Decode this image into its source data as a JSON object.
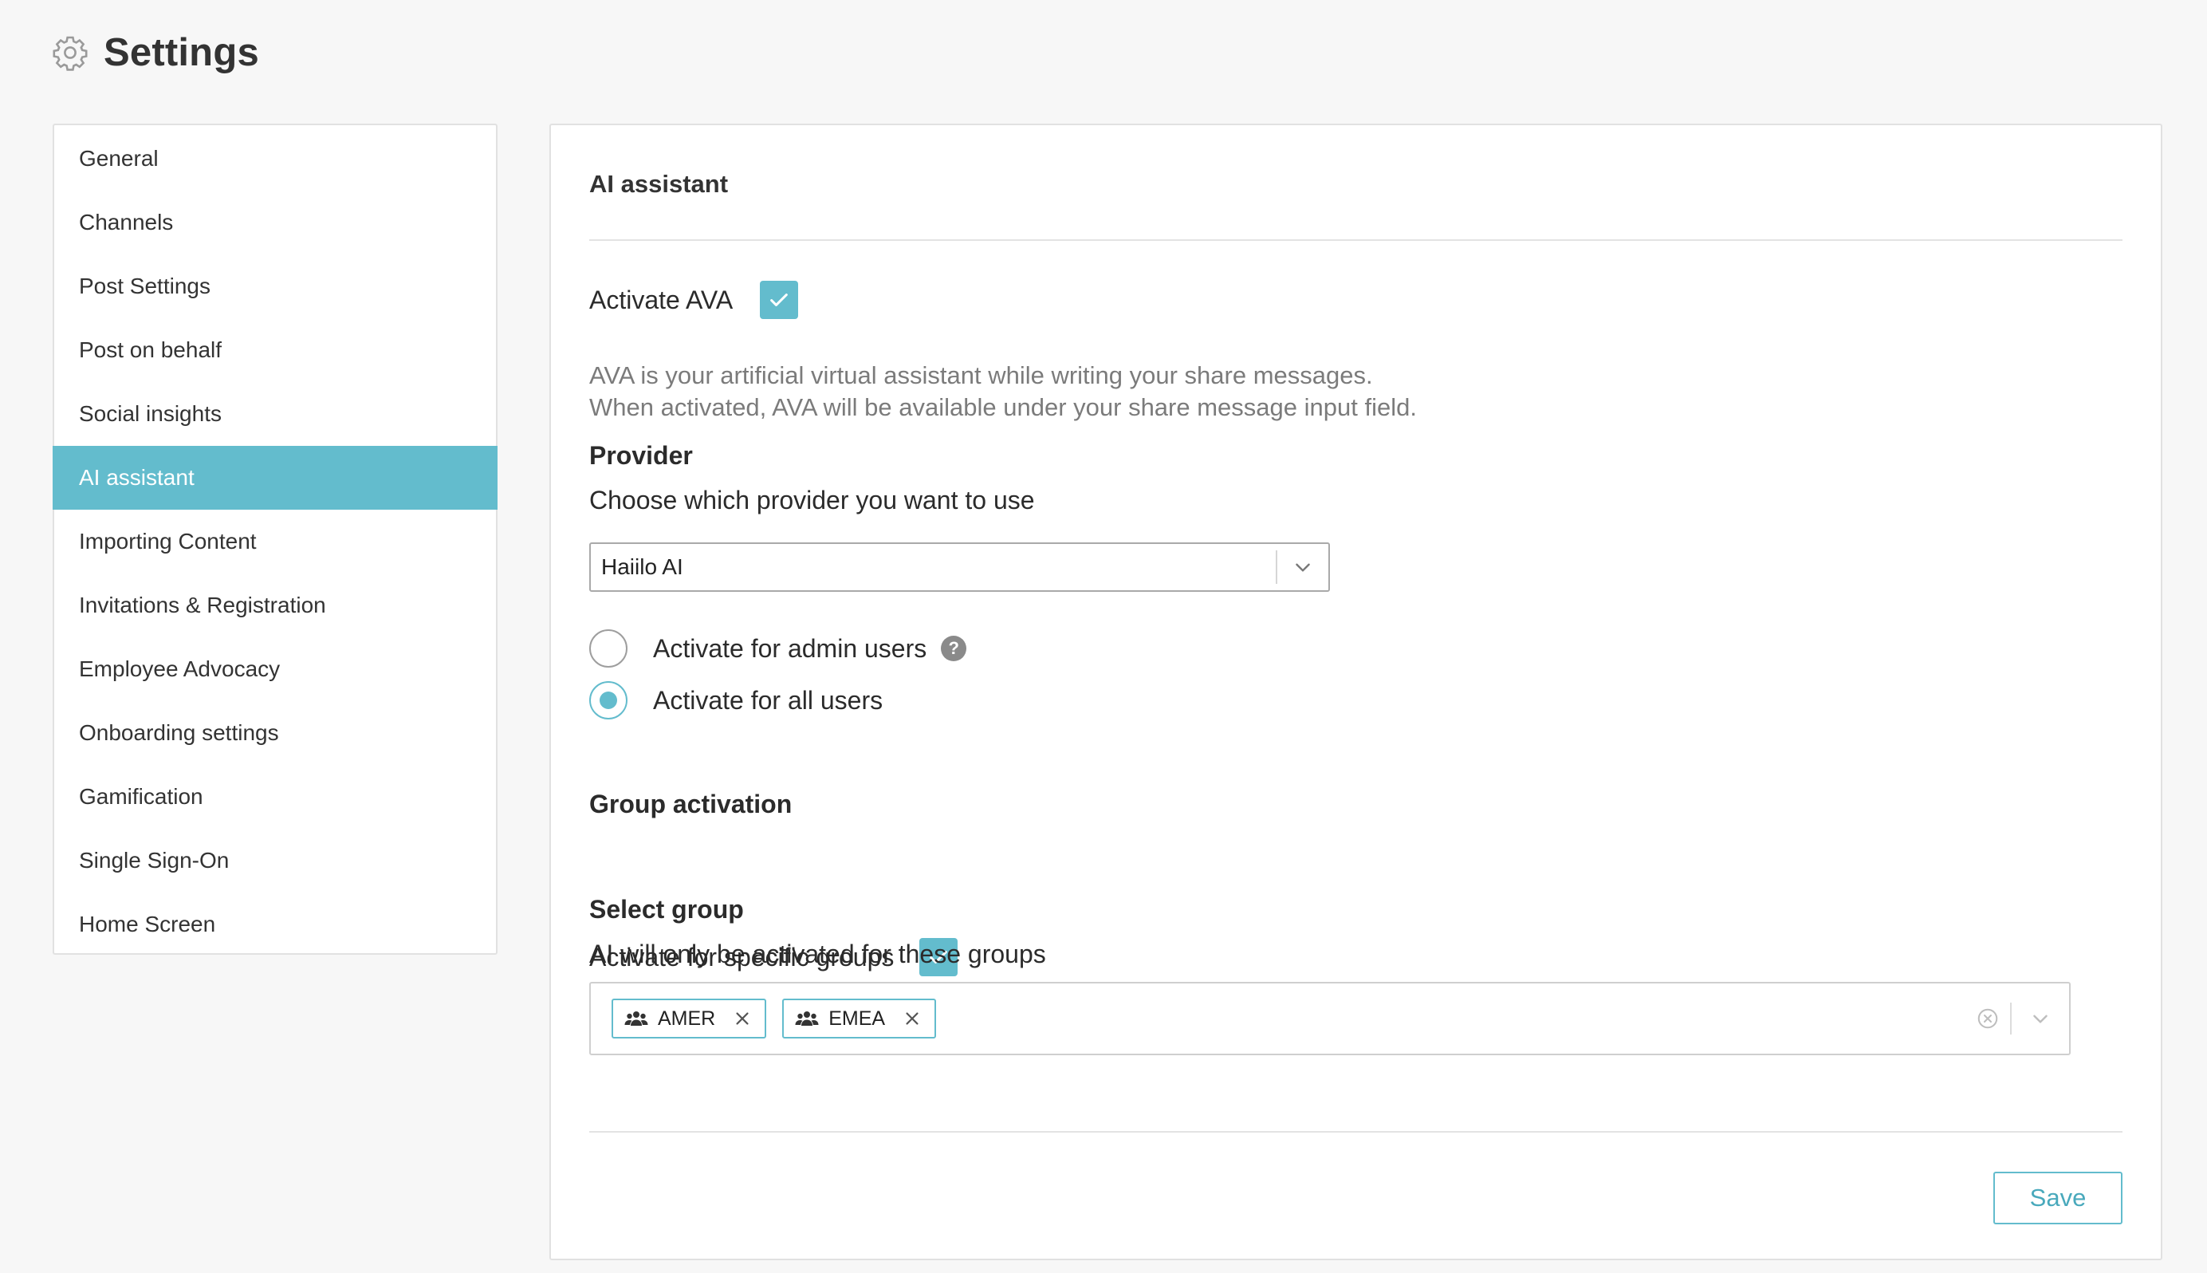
{
  "header": {
    "title": "Settings",
    "icon": "gear-icon"
  },
  "sidebar": {
    "active_index": 5,
    "items": [
      {
        "label": "General"
      },
      {
        "label": "Channels"
      },
      {
        "label": "Post Settings"
      },
      {
        "label": "Post on behalf"
      },
      {
        "label": "Social insights"
      },
      {
        "label": "AI assistant"
      },
      {
        "label": "Importing Content"
      },
      {
        "label": "Invitations & Registration"
      },
      {
        "label": "Employee Advocacy"
      },
      {
        "label": "Onboarding settings"
      },
      {
        "label": "Gamification"
      },
      {
        "label": "Single Sign-On"
      },
      {
        "label": "Home Screen"
      }
    ]
  },
  "panel": {
    "title": "AI assistant",
    "activate_label": "Activate AVA",
    "activate_checked": true,
    "description_line1": "AVA is your artificial virtual assistant while writing your share messages.",
    "description_line2": "When activated, AVA will be available under your share message input field.",
    "provider": {
      "heading": "Provider",
      "label": "Choose which provider you want to use",
      "selected": "Haiilo AI"
    },
    "audience": {
      "options": [
        {
          "label": "Activate for admin users",
          "checked": false,
          "has_help": true
        },
        {
          "label": "Activate for all users",
          "checked": true,
          "has_help": false
        }
      ],
      "help_glyph": "?"
    },
    "group_activation": {
      "heading": "Group activation",
      "label": "Activate for specific groups",
      "checked": true
    },
    "select_group": {
      "heading": "Select group",
      "label": "AI will only be activated for these groups",
      "tags": [
        {
          "label": "AMER",
          "icon": "group-icon"
        },
        {
          "label": "EMEA",
          "icon": "group-icon"
        }
      ]
    },
    "save_label": "Save"
  },
  "colors": {
    "accent": "#63bccd",
    "accent_text": "#49a9bc",
    "background": "#f7f7f7",
    "muted_text": "#7b7b7b"
  }
}
